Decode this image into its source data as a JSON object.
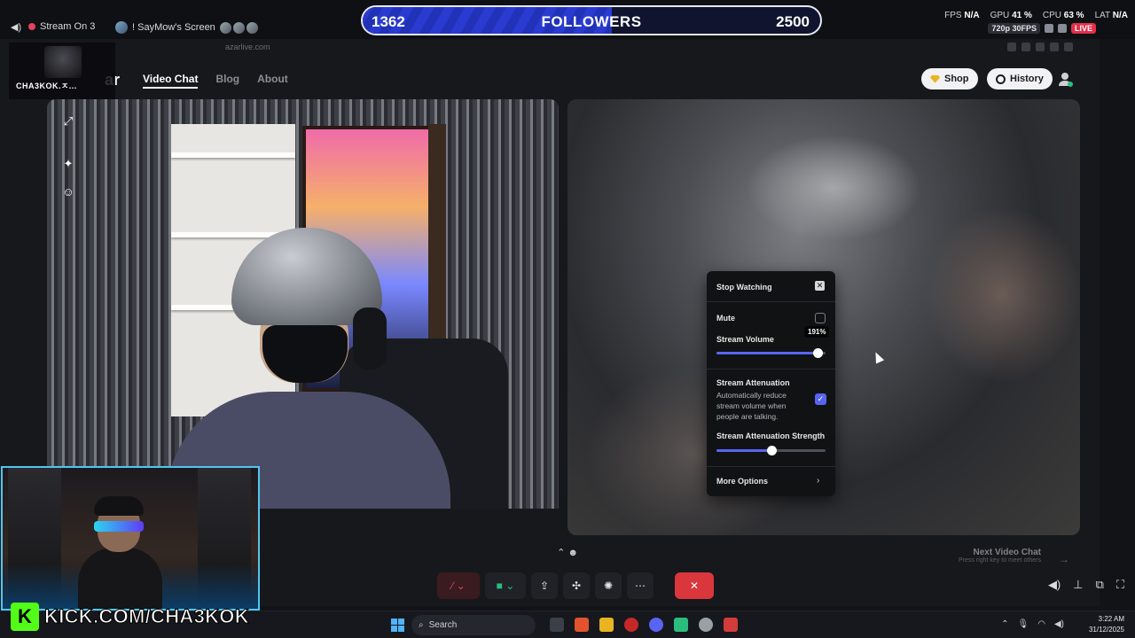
{
  "discord_bar": {
    "stream_label": "Stream On 3",
    "screen_label": "! SayMow's Screen"
  },
  "stats": {
    "fps_label": "FPS",
    "fps_value": "N/A",
    "gpu_label": "GPU",
    "gpu_value": "41 %",
    "cpu_label": "CPU",
    "cpu_value": "63 %",
    "lat_label": "LAT",
    "lat_value": "N/A",
    "quality": "720p 30FPS",
    "live": "LIVE"
  },
  "followers_goal": {
    "current": "1362",
    "label": "FOLLOWERS",
    "target": "2500",
    "progress": 0.5448
  },
  "browser": {
    "url": "azarlive.com"
  },
  "streamer_tag": {
    "name": "CHA3KOK.ㅈ..."
  },
  "site": {
    "logo": "ar",
    "nav": [
      "Video Chat",
      "Blog",
      "About"
    ],
    "shop_label": "Shop",
    "history_label": "History"
  },
  "next_chat": {
    "title": "Next Video Chat",
    "hint": "Press right key to meet others"
  },
  "stream_menu": {
    "stop_watching": "Stop Watching",
    "mute": "Mute",
    "mute_checked": false,
    "stream_volume_label": "Stream Volume",
    "stream_volume_value": "191%",
    "stream_volume_fraction": 0.93,
    "attenuation_label": "Stream Attenuation",
    "attenuation_desc": "Automatically reduce stream volume when people are talking.",
    "attenuation_checked": true,
    "attenuation_strength_label": "Stream Attenuation Strength",
    "attenuation_strength_fraction": 0.5,
    "more_options": "More Options"
  },
  "overlay": {
    "kick_letter": "K",
    "kick_url": "KICK.COM/CHA3KOK"
  },
  "taskbar": {
    "search_placeholder": "Search",
    "time": "3:22 AM",
    "date": "31/12/2025"
  },
  "colors": {
    "accent": "#5865f2",
    "end_call": "#da373c",
    "kick_green": "#53fc18",
    "goal_blue": "#2a3bd1"
  }
}
